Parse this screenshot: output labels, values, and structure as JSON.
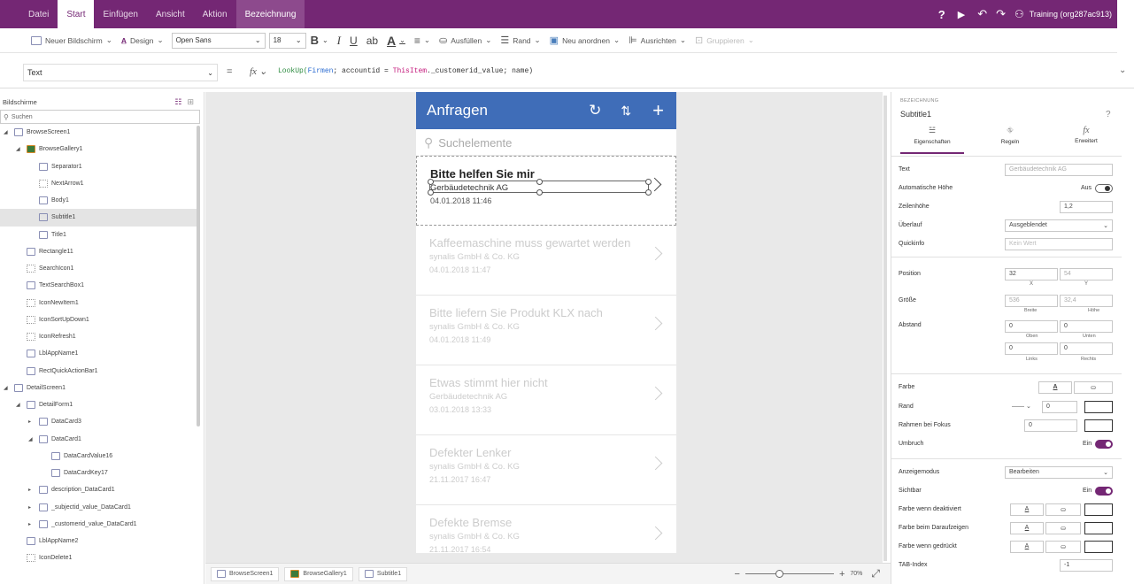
{
  "menubar": {
    "tabs": [
      "Datei",
      "Start",
      "Einfügen",
      "Ansicht",
      "Aktion"
    ],
    "active_tab": "Start",
    "context_tab": "Bezeichnung",
    "help": "?",
    "user": "Training (org287ac913)",
    "accent": "#742774"
  },
  "ribbon": {
    "new_screen": "Neuer Bildschirm",
    "design": "Design",
    "font": "Open Sans",
    "font_size": "18",
    "bold": "B",
    "italic": "I",
    "underline": "U",
    "ab": "ab",
    "font_color": "A",
    "fill": "Ausfüllen",
    "border": "Rand",
    "reorder": "Neu anordnen",
    "align": "Ausrichten",
    "group": "Gruppieren"
  },
  "formula": {
    "property": "Text",
    "equals": "=",
    "fx": "fx",
    "expr_func": "LookUp(",
    "expr_table": "Firmen",
    "expr_mid": "; accountid = ",
    "expr_item": "ThisItem",
    "expr_end": "._customerid_value; name)"
  },
  "left_panel": {
    "title": "Bildschirme",
    "search_placeholder": "Suchen",
    "tree": [
      {
        "label": "BrowseScreen1",
        "level": 0,
        "arrow": "◢"
      },
      {
        "label": "BrowseGallery1",
        "level": 1,
        "arrow": "◢"
      },
      {
        "label": "Separator1",
        "level": 2,
        "arrow": ""
      },
      {
        "label": "NextArrow1",
        "level": 2,
        "arrow": ""
      },
      {
        "label": "Body1",
        "level": 2,
        "arrow": ""
      },
      {
        "label": "Subtitle1",
        "level": 2,
        "arrow": "",
        "selected": true
      },
      {
        "label": "Title1",
        "level": 2,
        "arrow": ""
      },
      {
        "label": "Rectangle11",
        "level": 1,
        "arrow": ""
      },
      {
        "label": "SearchIcon1",
        "level": 1,
        "arrow": ""
      },
      {
        "label": "TextSearchBox1",
        "level": 1,
        "arrow": ""
      },
      {
        "label": "IconNewItem1",
        "level": 1,
        "arrow": ""
      },
      {
        "label": "IconSortUpDown1",
        "level": 1,
        "arrow": ""
      },
      {
        "label": "IconRefresh1",
        "level": 1,
        "arrow": ""
      },
      {
        "label": "LblAppName1",
        "level": 1,
        "arrow": ""
      },
      {
        "label": "RectQuickActionBar1",
        "level": 1,
        "arrow": ""
      },
      {
        "label": "DetailScreen1",
        "level": 0,
        "arrow": "◢"
      },
      {
        "label": "DetailForm1",
        "level": 1,
        "arrow": "◢"
      },
      {
        "label": "DataCard3",
        "level": 2,
        "arrow": "▸"
      },
      {
        "label": "DataCard1",
        "level": 2,
        "arrow": "◢"
      },
      {
        "label": "DataCardValue16",
        "level": 3,
        "arrow": ""
      },
      {
        "label": "DataCardKey17",
        "level": 3,
        "arrow": ""
      },
      {
        "label": "description_DataCard1",
        "level": 2,
        "arrow": "▸"
      },
      {
        "label": "_subjectid_value_DataCard1",
        "level": 2,
        "arrow": "▸"
      },
      {
        "label": "_customerid_value_DataCard1",
        "level": 2,
        "arrow": "▸"
      },
      {
        "label": "LblAppName2",
        "level": 1,
        "arrow": ""
      },
      {
        "label": "IconDelete1",
        "level": 1,
        "arrow": ""
      }
    ]
  },
  "app": {
    "title": "Anfragen",
    "refresh": "↻",
    "sort": "⇅",
    "add": "+",
    "search_placeholder": "Suchelemente",
    "items": [
      {
        "title": "Bitte helfen Sie mir",
        "subtitle": "Gerbäudetechnik AG",
        "date": "04.01.2018 11:46"
      },
      {
        "title": "Kaffeemaschine muss gewartet werden",
        "subtitle": "synalis GmbH & Co. KG",
        "date": "04.01.2018 11:47"
      },
      {
        "title": "Bitte liefern Sie Produkt KLX nach",
        "subtitle": "synalis GmbH & Co. KG",
        "date": "04.01.2018 11:49"
      },
      {
        "title": "Etwas stimmt hier nicht",
        "subtitle": "Gerbäudetechnik AG",
        "date": "03.01.2018 13:33"
      },
      {
        "title": "Defekter Lenker",
        "subtitle": "synalis GmbH & Co. KG",
        "date": "21.11.2017 16:47"
      },
      {
        "title": "Defekte Bremse",
        "subtitle": "synalis GmbH & Co. KG",
        "date": "21.11.2017 16:54"
      }
    ]
  },
  "bottom": {
    "tabs": [
      "BrowseScreen1",
      "BrowseGallery1",
      "Subtitle1"
    ],
    "zoom_minus": "−",
    "zoom_plus": "+",
    "zoom": "70%"
  },
  "props": {
    "section": "BEZEICHNUNG",
    "control": "Subtitle1",
    "tabs": [
      "Eigenschaften",
      "Regeln",
      "Erweitert"
    ],
    "text_label": "Text",
    "text_value": "Gerbäudetechnik AG",
    "autoheight_label": "Automatische Höhe",
    "autoheight_value": "Aus",
    "lineheight_label": "Zeilenhöhe",
    "lineheight_value": "1,2",
    "overflow_label": "Überlauf",
    "overflow_value": "Ausgeblendet",
    "tooltip_label": "Quickinfo",
    "tooltip_placeholder": "Kein Wert",
    "position_label": "Position",
    "pos_x": "32",
    "pos_y": "54",
    "x_label": "X",
    "y_label": "Y",
    "size_label": "Größe",
    "size_w": "536",
    "size_h": "32,4",
    "w_label": "Breite",
    "h_label": "Höhe",
    "padding_label": "Abstand",
    "pad_top": "0",
    "pad_bottom": "0",
    "pad_left": "0",
    "pad_right": "0",
    "top_label": "Oben",
    "bottom_label": "Unten",
    "left_label": "Links",
    "right_label": "Rechts",
    "color_label": "Farbe",
    "border_label": "Rand",
    "border_value": "0",
    "focus_border_label": "Rahmen bei Fokus",
    "focus_border_value": "0",
    "wrap_label": "Umbruch",
    "wrap_value": "Ein",
    "displaymode_label": "Anzeigemodus",
    "displaymode_value": "Bearbeiten",
    "visible_label": "Sichtbar",
    "visible_value": "Ein",
    "disabled_color_label": "Farbe wenn deaktiviert",
    "hover_color_label": "Farbe beim Daraufzeigen",
    "pressed_color_label": "Farbe wenn gedrückt",
    "tabindex_label": "TAB-Index",
    "tabindex_value": "-1",
    "font_a": "A"
  }
}
